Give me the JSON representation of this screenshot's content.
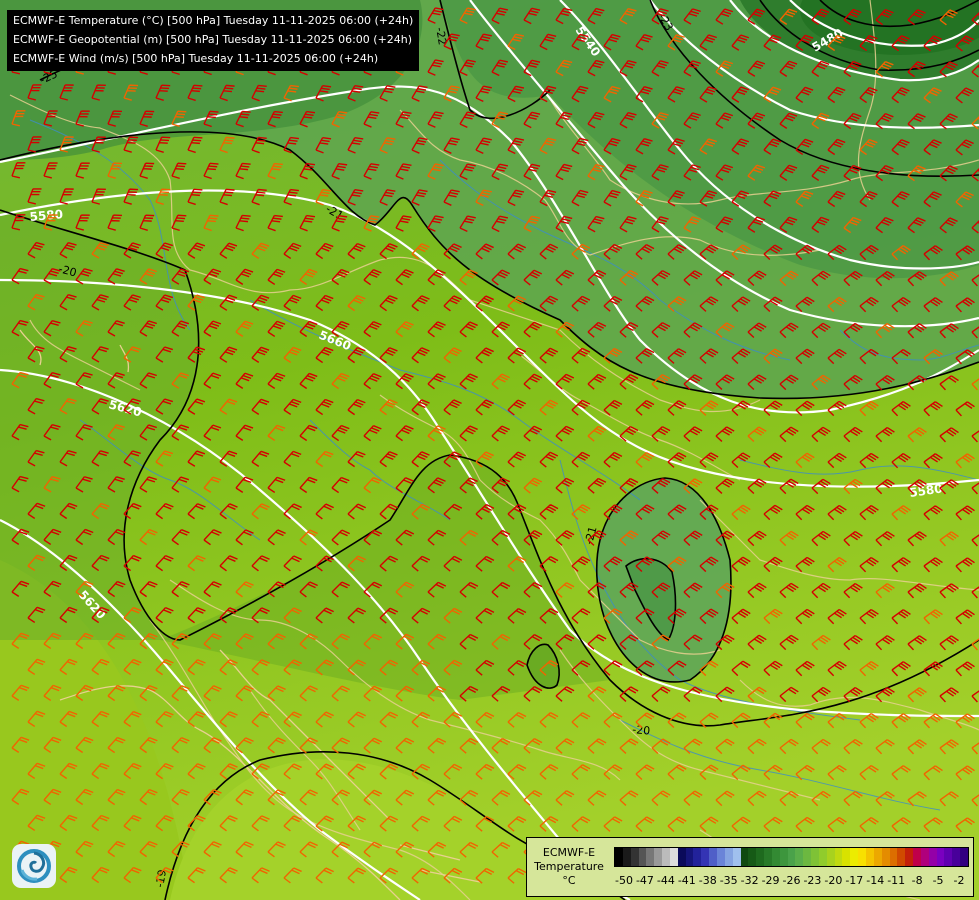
{
  "titles": {
    "line1": "ECMWF-E Temperature (°C) [500 hPa] Tuesday 11-11-2025 06:00 (+24h)",
    "line2": "ECMWF-E Geopotential (m) [500 hPa] Tuesday 11-11-2025 06:00 (+24h)",
    "line3": "ECMWF-E Wind (m/s) [500 hPa] Tuesday 11-11-2025 06:00 (+24h)"
  },
  "geopotential_labels": [
    "5540",
    "5480",
    "5580",
    "5620",
    "5660",
    "5620",
    "5580"
  ],
  "temperature_labels": [
    "-22",
    "-23",
    "-25",
    "-21",
    "-20",
    "-21",
    "-20",
    "-19"
  ],
  "legend": {
    "title": "ECMWF-E Temperature °C",
    "title_line1": "ECMWF-E",
    "title_line2": "Temperature",
    "title_line3": "°C",
    "ticks": [
      "-50",
      "-47",
      "-44",
      "-41",
      "-38",
      "-35",
      "-32",
      "-29",
      "-26",
      "-23",
      "-20",
      "-17",
      "-14",
      "-11",
      "-8",
      "-5",
      "-2"
    ],
    "colors": [
      "#000000",
      "#1a1a1a",
      "#333333",
      "#555555",
      "#777777",
      "#999999",
      "#bbbbbb",
      "#dddddd",
      "#0a0a5a",
      "#15157a",
      "#22229a",
      "#3434b4",
      "#4f5fc8",
      "#6a84d8",
      "#85a4e2",
      "#a0c0ee",
      "#0f4a10",
      "#165a16",
      "#1e6a1e",
      "#287a28",
      "#338a33",
      "#3d963d",
      "#4aa24a",
      "#5aae4a",
      "#6cb840",
      "#7ec236",
      "#90cc2c",
      "#a8d21e",
      "#c0da10",
      "#d8e200",
      "#ecec00",
      "#f8e000",
      "#f4c400",
      "#eca800",
      "#e48c00",
      "#dc6e00",
      "#d04a00",
      "#c4200a",
      "#c0004a",
      "#b0007c",
      "#9400a8",
      "#7a00c0",
      "#6000b0",
      "#48009a",
      "#320080"
    ],
    "logo": "ecmwf-swirl-icon"
  },
  "colors": {
    "wind_barb_strong": "#d40000",
    "wind_barb_medium": "#f06400",
    "geopotential_contour": "#ffffff",
    "temperature_contour": "#000000",
    "borders": "#e8d090",
    "rivers": "#3c8cc8"
  }
}
